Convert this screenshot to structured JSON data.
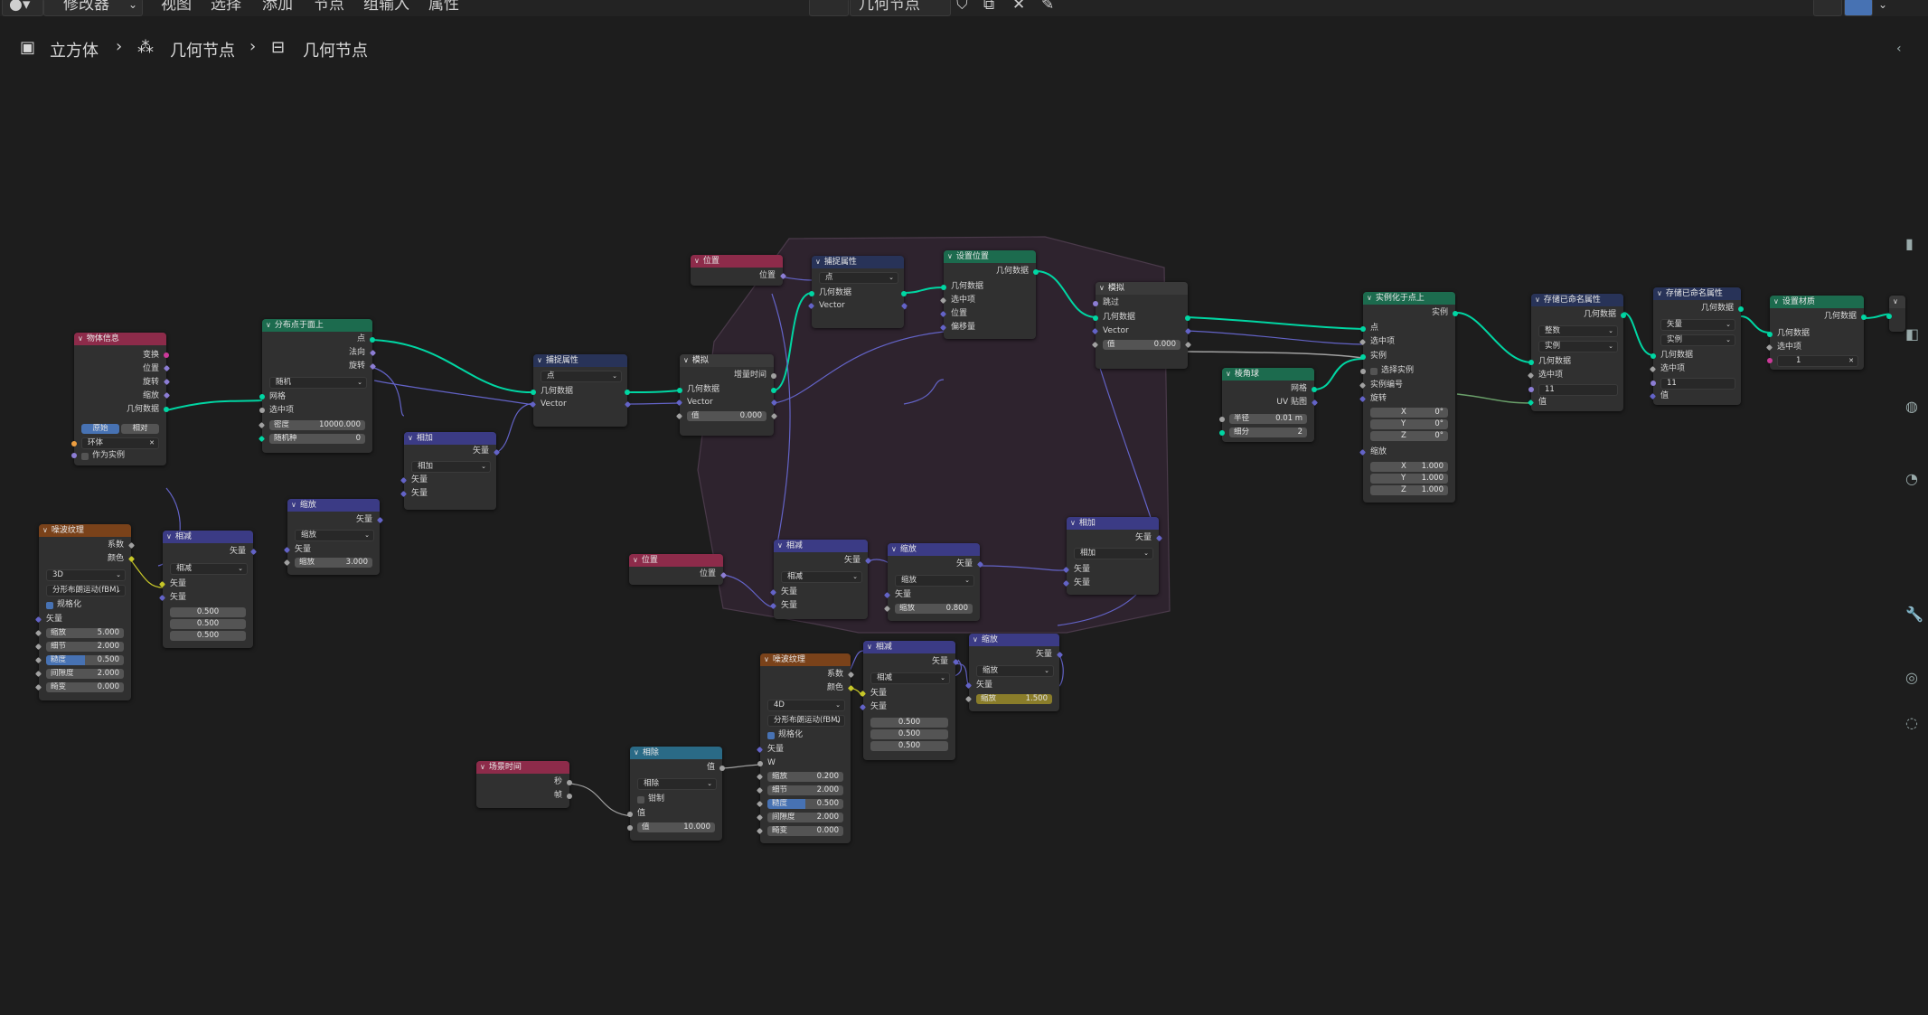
{
  "header": {
    "editor_type_label": "修改器",
    "menu": [
      "视图",
      "选择",
      "添加",
      "节点",
      "组输入",
      "属性"
    ],
    "node_group_name": "几何节点"
  },
  "breadcrumb": [
    "立方体",
    "几何节点",
    "几何节点"
  ],
  "frame_color": "#3a2a3a",
  "nodes": {
    "object_info": {
      "title": "物体信息",
      "out": [
        "变换",
        "位置",
        "旋转",
        "缩放",
        "几何数据"
      ],
      "seg": [
        "原始",
        "相对"
      ],
      "obj": "环体",
      "as_instance": "作为实例"
    },
    "distribute": {
      "title": "分布点于面上",
      "out": [
        "点",
        "法向",
        "旋转"
      ],
      "mode": "随机",
      "in": [
        "网格",
        "选中项"
      ],
      "density_label": "密度",
      "density": "10000.000",
      "seed_label": "随机种",
      "seed": "0"
    },
    "capture1": {
      "title": "捕捉属性",
      "domain": "点",
      "rows": [
        "几何数据",
        "Vector"
      ]
    },
    "simulate1": {
      "title": "模拟",
      "out": "增量时间",
      "rows": [
        "几何数据",
        "Vector"
      ],
      "val_label": "值",
      "val": "0.000"
    },
    "position_top": {
      "title": "位置",
      "out": "位置"
    },
    "capture2": {
      "title": "捕捉属性",
      "domain": "点",
      "rows": [
        "几何数据",
        "Vector"
      ]
    },
    "set_position": {
      "title": "设置位置",
      "out": "几何数据",
      "in": [
        "几何数据",
        "选中项",
        "位置",
        "偏移量"
      ]
    },
    "simulate2": {
      "title": "模拟",
      "rows": [
        "跳过",
        "几何数据",
        "Vector"
      ],
      "val_label": "值",
      "val": "0.000"
    },
    "instance_on_points": {
      "title": "实例化于点上",
      "out": "实例",
      "in": [
        "点",
        "选中项",
        "实例",
        "选择实例",
        "实例编号",
        "旋转"
      ],
      "rot": [
        "X",
        "0°",
        "Y",
        "0°",
        "Z",
        "0°"
      ],
      "scale_label": "缩放",
      "scale": [
        "X",
        "1.000",
        "Y",
        "1.000",
        "Z",
        "1.000"
      ]
    },
    "ico_sphere": {
      "title": "棱角球",
      "out": [
        "网格",
        "UV 贴图"
      ],
      "radius_label": "半径",
      "radius": "0.01 m",
      "sub_label": "细分",
      "sub": "2"
    },
    "store1": {
      "title": "存储已命名属性",
      "out": "几何数据",
      "type": "整数",
      "domain": "实例",
      "in": [
        "几何数据",
        "选中项"
      ],
      "name": "11",
      "val": "值"
    },
    "store2": {
      "title": "存储已命名属性",
      "out": "几何数据",
      "type": "矢量",
      "domain": "实例",
      "in": [
        "几何数据",
        "选中项"
      ],
      "name": "11",
      "val": "值"
    },
    "set_material": {
      "title": "设置材质",
      "out": "几何数据",
      "in": [
        "几何数据",
        "选中项"
      ],
      "mat": "1"
    },
    "add1": {
      "title": "相加",
      "out": "矢量",
      "op": "相加",
      "in": [
        "矢量",
        "矢量"
      ]
    },
    "noise1": {
      "title": "噪波纹理",
      "out": [
        "系数",
        "颜色"
      ],
      "dim": "3D",
      "type": "分形布朗运动(fBM)",
      "normalize": "规格化",
      "vec": "矢量",
      "fields": [
        [
          "缩放",
          "5.000"
        ],
        [
          "细节",
          "2.000"
        ],
        [
          "糙度",
          "0.500"
        ],
        [
          "间隙度",
          "2.000"
        ],
        [
          "畸变",
          "0.000"
        ]
      ]
    },
    "sub1": {
      "title": "相减",
      "out": "矢量",
      "op": "相减",
      "in": [
        "矢量",
        "矢量"
      ],
      "vals": [
        "0.500",
        "0.500",
        "0.500"
      ]
    },
    "scale1": {
      "title": "缩放",
      "out": "矢量",
      "op": "缩放",
      "in": "矢量",
      "scale_label": "缩放",
      "scale": "3.000"
    },
    "position_bottom": {
      "title": "位置",
      "out": "位置"
    },
    "sub2": {
      "title": "相减",
      "out": "矢量",
      "op": "相减",
      "in": [
        "矢量",
        "矢量"
      ]
    },
    "scale2": {
      "title": "缩放",
      "out": "矢量",
      "op": "缩放",
      "in": "矢量",
      "scale_label": "缩放",
      "scale": "0.800"
    },
    "add2": {
      "title": "相加",
      "out": "矢量",
      "op": "相加",
      "in": [
        "矢量",
        "矢量"
      ]
    },
    "noise2": {
      "title": "噪波纹理",
      "out": [
        "系数",
        "颜色"
      ],
      "dim": "4D",
      "type": "分形布朗运动(fBM)",
      "normalize": "规格化",
      "vec": "矢量",
      "w": "W",
      "fields": [
        [
          "缩放",
          "0.200"
        ],
        [
          "细节",
          "2.000"
        ],
        [
          "糙度",
          "0.500"
        ],
        [
          "间隙度",
          "2.000"
        ],
        [
          "畸变",
          "0.000"
        ]
      ]
    },
    "sub3": {
      "title": "相减",
      "out": "矢量",
      "op": "相减",
      "in": [
        "矢量",
        "矢量"
      ],
      "vals": [
        "0.500",
        "0.500",
        "0.500"
      ]
    },
    "scale3": {
      "title": "缩放",
      "out": "矢量",
      "op": "缩放",
      "in": "矢量",
      "scale_label": "缩放",
      "scale": "1.500"
    },
    "scene_time": {
      "title": "场景时间",
      "out": [
        "秒",
        "帧"
      ]
    },
    "divide": {
      "title": "相除",
      "out": "值",
      "op": "相除",
      "clamp": "钳制",
      "in": "值",
      "val_label": "值",
      "val": "10.000"
    }
  }
}
